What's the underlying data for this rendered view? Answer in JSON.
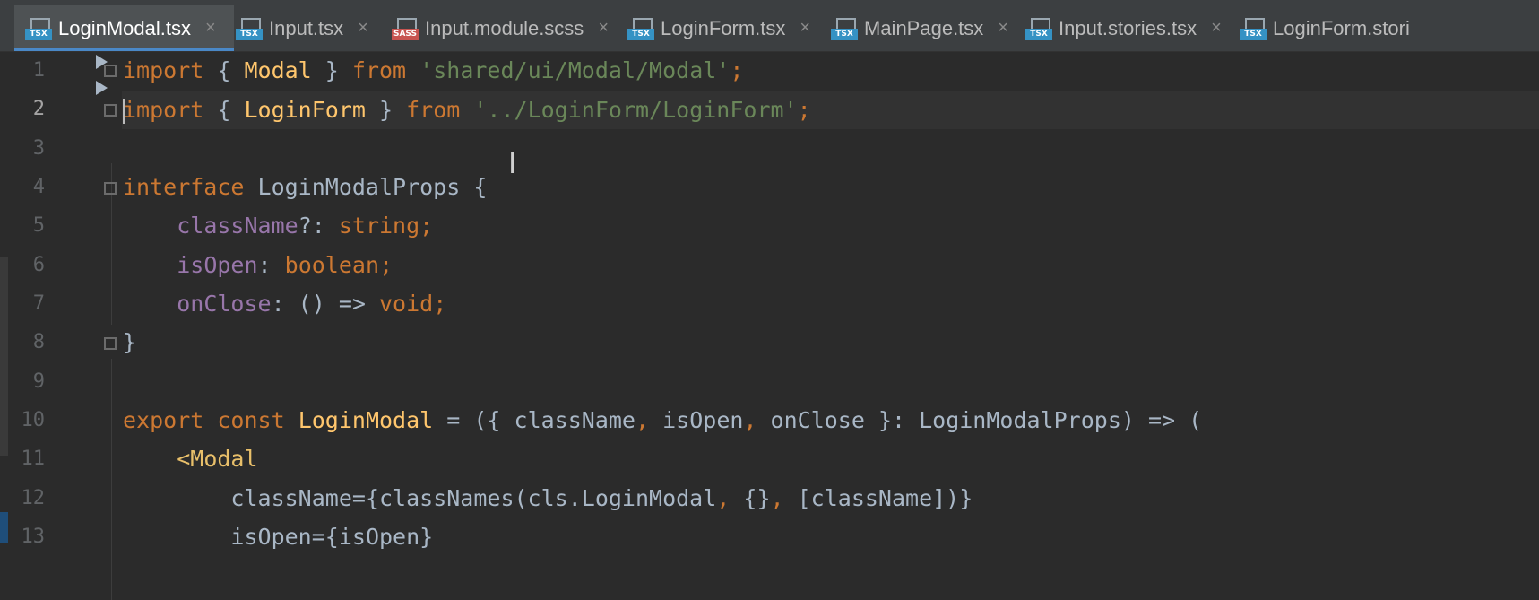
{
  "tabs": [
    {
      "name": "LoginModal.tsx",
      "icon": "tsx-file-icon",
      "badge": "TSX",
      "active": true
    },
    {
      "name": "Input.tsx",
      "icon": "tsx-file-icon",
      "badge": "TSX",
      "active": false
    },
    {
      "name": "Input.module.scss",
      "icon": "sass-file-icon",
      "badge": "SASS",
      "active": false
    },
    {
      "name": "LoginForm.tsx",
      "icon": "tsx-file-icon",
      "badge": "TSX",
      "active": false
    },
    {
      "name": "MainPage.tsx",
      "icon": "tsx-file-icon",
      "badge": "TSX",
      "active": false
    },
    {
      "name": "Input.stories.tsx",
      "icon": "tsx-file-icon",
      "badge": "TSX",
      "active": false
    },
    {
      "name": "LoginForm.stori",
      "icon": "tsx-file-icon",
      "badge": "TSX",
      "active": false
    }
  ],
  "close_glyph": "×",
  "line_numbers": [
    "1",
    "2",
    "3",
    "4",
    "5",
    "6",
    "7",
    "8",
    "9",
    "10",
    "11",
    "12",
    "13"
  ],
  "code": {
    "l1": [
      "import",
      " { ",
      "Modal",
      " } ",
      "from",
      " ",
      "'shared/ui/Modal/Modal'",
      ";"
    ],
    "l2": [
      "import",
      " { ",
      "LoginForm",
      " } ",
      "from",
      " ",
      "'../LoginForm/LoginForm'",
      ";"
    ],
    "l4": [
      "interface",
      " LoginModalProps {"
    ],
    "l5": [
      "    ",
      "className",
      "?: ",
      "string",
      ";"
    ],
    "l6": [
      "    ",
      "isOpen",
      ": ",
      "boolean",
      ";"
    ],
    "l7": [
      "    ",
      "onClose",
      ": () => ",
      "void",
      ";"
    ],
    "l8": [
      "}"
    ],
    "l10": [
      "export",
      " ",
      "const",
      " ",
      "LoginModal",
      " = ({ className",
      ",",
      " isOpen",
      ",",
      " onClose }: LoginModalProps) => ("
    ],
    "l11": [
      "    ",
      "<Modal"
    ],
    "l12": [
      "        ",
      "className",
      "={classNames(cls.LoginModal",
      ",",
      " {}",
      ",",
      " [className])}"
    ],
    "l13": [
      "        ",
      "isOpen",
      "={isOpen}"
    ]
  },
  "colors": {
    "keyword": "#cc7832",
    "string": "#6a8759",
    "property": "#9876aa",
    "function": "#ffc66d",
    "tag": "#e8bf6a",
    "text": "#a9b7c6",
    "tab_accent": "#4a88c7"
  }
}
